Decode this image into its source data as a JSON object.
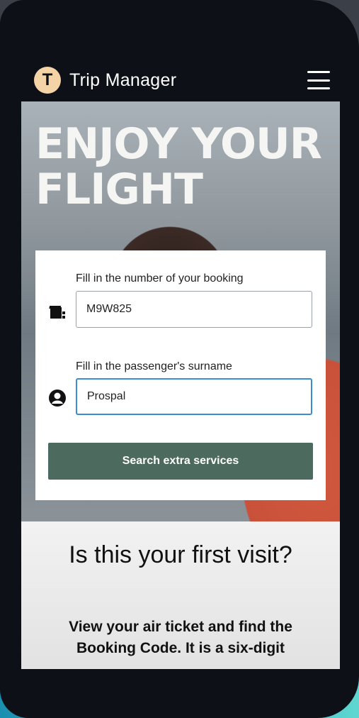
{
  "header": {
    "app_name": "Trip Manager",
    "logo_glyph": "T"
  },
  "hero": {
    "title_line1": "ENJOY YOUR",
    "title_line2": "FLIGHT"
  },
  "form": {
    "booking_label": "Fill in the number of your booking",
    "booking_value": "M9W825",
    "surname_label": "Fill in the passenger's surname",
    "surname_value": "Prospal",
    "submit_label": "Search extra services"
  },
  "info": {
    "heading": "Is this your first visit?",
    "body": "View your air ticket and find the Booking Code. It is a six-digit"
  },
  "colors": {
    "header_bg": "#0d1117",
    "logo_bg": "#f4d3a6",
    "button_bg": "#4d6a5e",
    "focus_border": "#3c8ccf"
  },
  "icons": {
    "menu": "hamburger-menu-icon",
    "booking": "ticket-icon",
    "passenger": "user-circle-icon"
  }
}
